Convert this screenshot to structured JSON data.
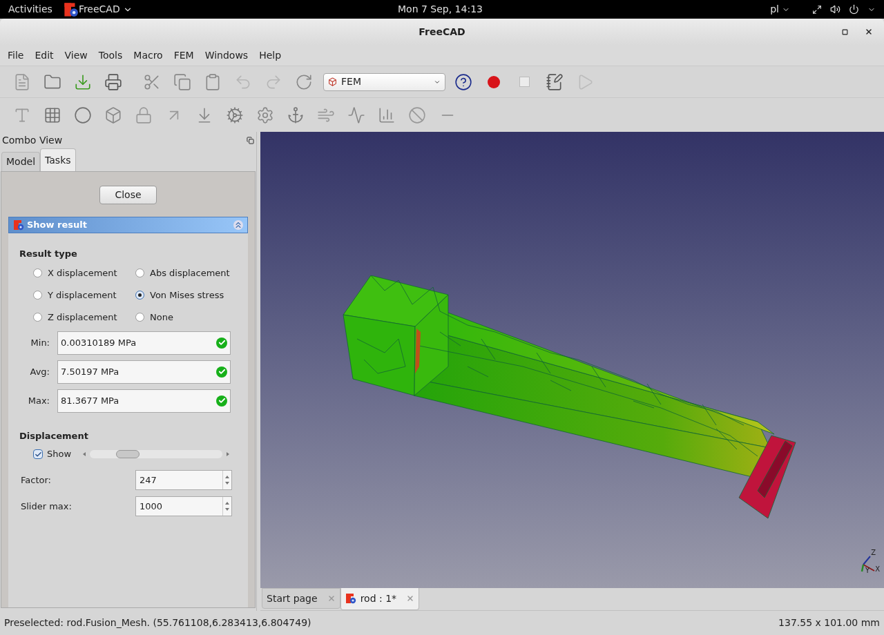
{
  "top_bar": {
    "activities": "Activities",
    "app_menu": "FreeCAD",
    "clock": "Mon  7 Sep, 14:13",
    "keyboard": "pl"
  },
  "window": {
    "title": "FreeCAD"
  },
  "menu": [
    "File",
    "Edit",
    "View",
    "Tools",
    "Macro",
    "FEM",
    "Windows",
    "Help"
  ],
  "workbench": {
    "value": "FEM"
  },
  "combo_view": {
    "title": "Combo View",
    "tabs": [
      {
        "label": "Model",
        "selected": false
      },
      {
        "label": "Tasks",
        "selected": true
      }
    ],
    "close_button": "Close",
    "panel_title": "Show result",
    "result_type": {
      "title": "Result type",
      "options": [
        {
          "label": "X displacement",
          "selected": false
        },
        {
          "label": "Abs displacement",
          "selected": false
        },
        {
          "label": "Y displacement",
          "selected": false
        },
        {
          "label": "Von Mises stress",
          "selected": true
        },
        {
          "label": "Z displacement",
          "selected": false
        },
        {
          "label": "None",
          "selected": false
        }
      ]
    },
    "stats": [
      {
        "label": "Min:",
        "value": "0.00310189 MPa"
      },
      {
        "label": "Avg:",
        "value": "7.50197 MPa"
      },
      {
        "label": "Max:",
        "value": "81.3677 MPa"
      }
    ],
    "displacement": {
      "title": "Displacement",
      "show": {
        "label": "Show",
        "checked": true
      },
      "slider": {
        "level": 0.24
      },
      "spins": [
        {
          "label": "Factor:",
          "value": "247"
        },
        {
          "label": "Slider max:",
          "value": "1000"
        }
      ]
    }
  },
  "viewport": {
    "axes": [
      "Z",
      "Y",
      "X"
    ]
  },
  "document_tabs": [
    {
      "label": "Start page",
      "selected": false
    },
    {
      "label": "rod : 1*",
      "selected": true
    }
  ],
  "status_bar": {
    "message": "Preselected: rod.Fusion_Mesh. (55.761108,6.283413,6.804749)",
    "dimensions": "137.55 x 101.00 mm"
  }
}
